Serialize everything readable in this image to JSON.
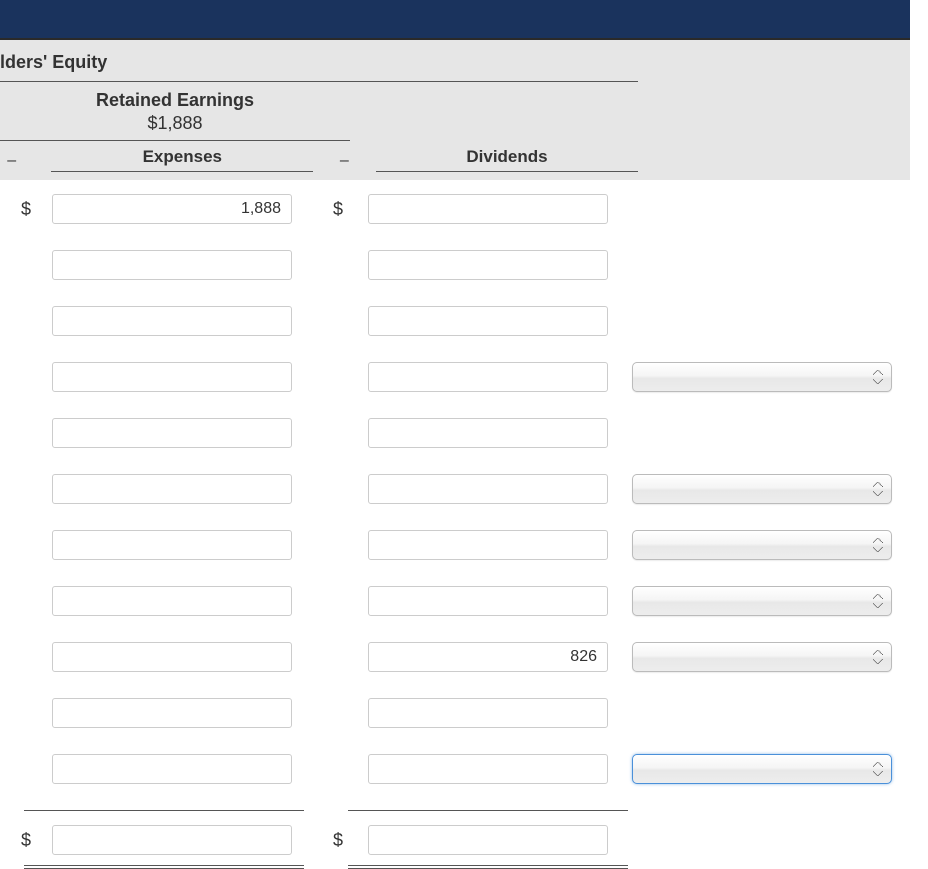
{
  "section_title": "lders' Equity",
  "retained": {
    "title": "Retained Earnings",
    "value": "$1,888"
  },
  "subheaders": {
    "expenses": "Expenses",
    "dividends": "Dividends",
    "minus": "–"
  },
  "currency": "$",
  "rows": [
    {
      "expense": "1,888",
      "dividend": "",
      "showDollar": true,
      "select": null
    },
    {
      "expense": "",
      "dividend": "",
      "showDollar": false,
      "select": null
    },
    {
      "expense": "",
      "dividend": "",
      "showDollar": false,
      "select": null
    },
    {
      "expense": "",
      "dividend": "",
      "showDollar": false,
      "select": ""
    },
    {
      "expense": "",
      "dividend": "",
      "showDollar": false,
      "select": null
    },
    {
      "expense": "",
      "dividend": "",
      "showDollar": false,
      "select": ""
    },
    {
      "expense": "",
      "dividend": "",
      "showDollar": false,
      "select": ""
    },
    {
      "expense": "",
      "dividend": "",
      "showDollar": false,
      "select": ""
    },
    {
      "expense": "",
      "dividend": "826",
      "showDollar": false,
      "select": ""
    },
    {
      "expense": "",
      "dividend": "",
      "showDollar": false,
      "select": null
    },
    {
      "expense": "",
      "dividend": "",
      "showDollar": false,
      "select": "",
      "selectFocused": true
    }
  ],
  "totals": {
    "expense": "",
    "dividend": ""
  }
}
